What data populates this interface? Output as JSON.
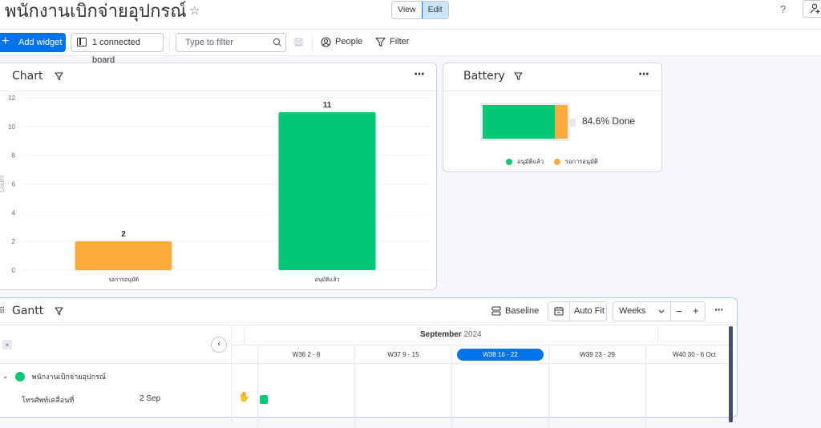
{
  "header": {
    "board_title": "พนักงานเบิกจ่ายอุปกรณ์",
    "view_label": "View",
    "edit_label": "Edit",
    "help_label": "?"
  },
  "toolbar": {
    "add_widget_label": "Add widget",
    "connected_board_label": "1 connected board",
    "filter_placeholder": "Type to filter",
    "people_label": "People",
    "filter_label": "Filter"
  },
  "chart_widget": {
    "title": "Chart"
  },
  "chart_data": {
    "type": "bar",
    "title": "Chart",
    "categories": [
      "รอการอนุมัติ",
      "อนุมัติแล้ว"
    ],
    "values": [
      2,
      11
    ],
    "colors": [
      "#fdab3d",
      "#00c875"
    ],
    "xlabel": "",
    "ylabel": "Count",
    "ylim": [
      0,
      12
    ],
    "yticks": [
      0,
      2,
      4,
      6,
      8,
      10,
      12
    ],
    "grid": true
  },
  "battery_widget": {
    "title": "Battery",
    "done_text": "84.6% Done",
    "segments": [
      {
        "label": "อนุมัติแล้ว",
        "value": 11,
        "color": "#00c875"
      },
      {
        "label": "รอการอนุมัติ",
        "value": 2,
        "color": "#fdab3d"
      }
    ],
    "done_percent": 84.6
  },
  "gantt_widget": {
    "title": "Gantt",
    "baseline_label": "Baseline",
    "autofit_label": "Auto Fit",
    "scale_label": "Weeks",
    "month_label_bold": "September",
    "month_label_year": "2024",
    "weeks": [
      {
        "label": "W36 2 - 8",
        "current": false
      },
      {
        "label": "W37 9 - 15",
        "current": false
      },
      {
        "label": "W38 16 - 22",
        "current": true
      },
      {
        "label": "W39 23 - 29",
        "current": false
      },
      {
        "label": "W40 30 - 6 Oct",
        "current": false
      }
    ],
    "group": {
      "name": "พนักงานเบิกจ่ายอุปกรณ์",
      "color": "#00c875"
    },
    "items": [
      {
        "name": "โทรศัพท์เคลื่อนที่",
        "date": "2 Sep"
      }
    ]
  }
}
